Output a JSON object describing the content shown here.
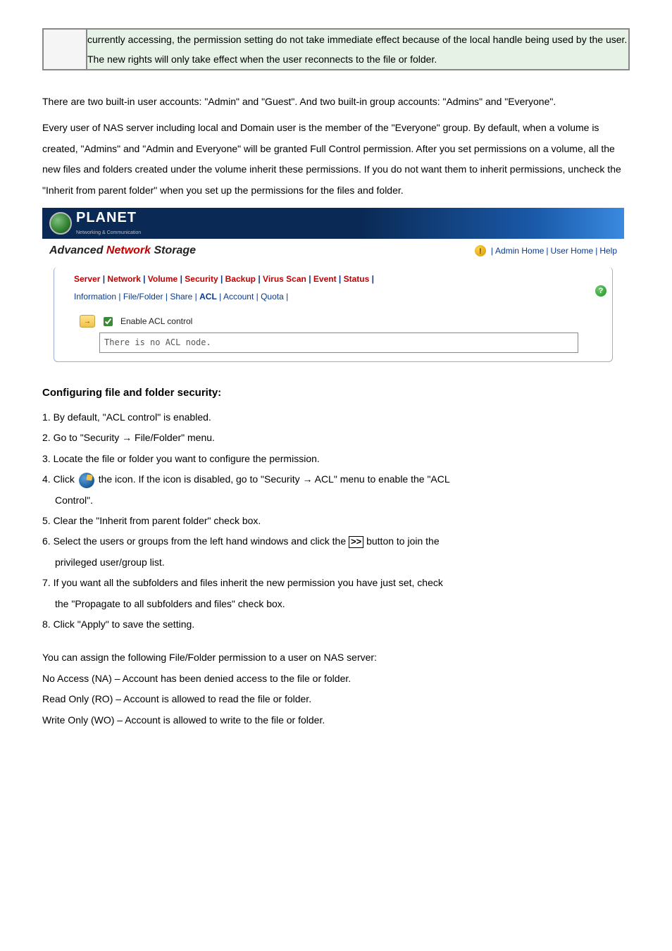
{
  "top_note": "currently accessing, the permission setting do not take immediate effect because of the local handle being used by the user. The new rights will only take effect when the user reconnects to the file or folder.",
  "intro": {
    "p1": "There are two built-in user accounts: \"Admin\" and \"Guest\". And two built-in group accounts: \"Admins\" and \"Everyone\".",
    "p2": "Every user of NAS server including local and Domain user is the member of the \"Everyone\" group. By default, when a volume is created, \"Admins\" and \"Admin and Everyone\" will be granted Full Control permission. After you set permissions on a volume, all the new files and folders created under the volume inherit these permissions. If you do not want them to inherit permissions, uncheck the \"Inherit from parent folder\" when you set up the permissions for the files and folder."
  },
  "screenshot": {
    "logo_text": "PLANET",
    "logo_sub": "Networking & Communication",
    "title_prefix": "Advanced ",
    "title_highlight": "Network",
    "title_suffix": " Storage",
    "links": [
      "Admin Home",
      "User Home",
      "Help"
    ],
    "tabs": [
      "Server",
      "Network",
      "Volume",
      "Security",
      "Backup",
      "Virus Scan",
      "Event",
      "Status"
    ],
    "subtabs": [
      "Information",
      "File/Folder",
      "Share",
      "ACL",
      "Account",
      "Quota"
    ],
    "subtabs_bold_index": 3,
    "checkbox_label": "Enable ACL control",
    "status_text": "There is no ACL node."
  },
  "section_heading": "Configuring file and folder security:",
  "steps": {
    "s1": "1. By default, \"ACL control\" is enabled.",
    "s2": "2. Go to \"Security → File/Folder\" menu.",
    "s3": "3. Locate the file or folder you want to configure the permission.",
    "s4a": "4. Click ",
    "s4b": "the icon. If the icon is disabled, go to \"Security → ACL\" menu to enable the \"ACL",
    "s4c": "Control\".",
    "s5": "5. Clear the \"Inherit from parent folder\" check box.",
    "s6a": "6. Select the users or groups from the left hand windows and click the ",
    "s6btn": ">>",
    "s6b": " button to join the",
    "s6c": "privileged user/group list.",
    "s7a": "7. If you want all the subfolders and files inherit the new permission you have just set, check",
    "s7b": "the \"Propagate to all subfolders and files\" check box.",
    "s8": "8. Click \"Apply\" to save the setting."
  },
  "permissions": {
    "intro": "You can assign the following File/Folder permission to a user on NAS server:",
    "na": "No Access (NA) – Account has been denied access to the file or folder.",
    "ro": "Read Only (RO) – Account is allowed to read the file or folder.",
    "wo": "Write Only (WO) – Account is allowed to write to the file or folder."
  }
}
